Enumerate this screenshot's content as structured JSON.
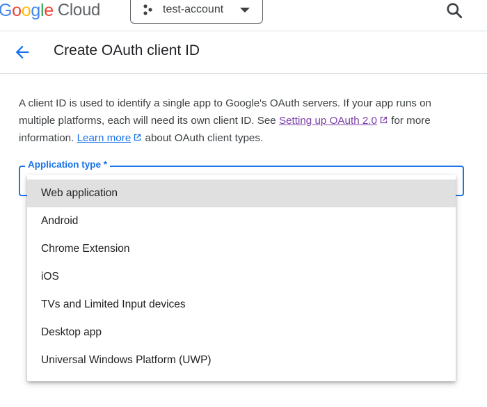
{
  "topbar": {
    "logo_google": [
      "G",
      "o",
      "o",
      "g",
      "l",
      "e"
    ],
    "logo_cloud": "Cloud",
    "project_name": "test-account"
  },
  "header": {
    "title": "Create OAuth client ID"
  },
  "description": {
    "text1": "A client ID is used to identify a single app to Google's OAuth servers. If your app runs on multiple platforms, each will need its own client ID. See",
    "link1": "Setting up OAuth 2.0",
    "text2": "for more information.",
    "link2": "Learn more",
    "text3": "about OAuth client types."
  },
  "field": {
    "label": "Application type *"
  },
  "menu": {
    "items": [
      "Web application",
      "Android",
      "Chrome Extension",
      "iOS",
      "TVs and Limited Input devices",
      "Desktop app",
      "Universal Windows Platform (UWP)"
    ],
    "selected_index": 0
  },
  "colors": {
    "accent": "#1a73e8",
    "visited_link": "#7b3fa8",
    "logo": [
      "#4285f4",
      "#ea4335",
      "#fbbc05",
      "#4285f4",
      "#34a853",
      "#ea4335"
    ]
  },
  "icons": {
    "search": "search-icon",
    "back": "arrow-back-icon",
    "project": "project-dots-icon",
    "external": "external-link-icon",
    "dropdown": "caret-down-icon"
  }
}
